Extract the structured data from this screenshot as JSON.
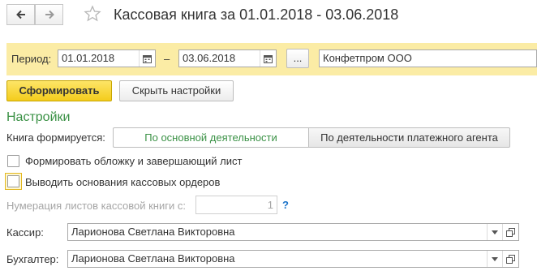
{
  "window": {
    "title": "Кассовая книга за 01.01.2018 - 03.06.2018",
    "nav_back_icon": "arrow-left-icon",
    "nav_forward_icon": "arrow-right-icon",
    "favorite_icon": "star-icon"
  },
  "period": {
    "label": "Период:",
    "date_from": "01.01.2018",
    "separator": "–",
    "date_to": "03.06.2018",
    "choose_button": "...",
    "organization": "Конфетпром ООО"
  },
  "toolbar": {
    "generate_label": "Сформировать",
    "hide_settings_label": "Скрыть настройки"
  },
  "settings": {
    "title": "Настройки",
    "book_mode_label": "Книга формируется:",
    "mode_main": "По основной деятельности",
    "mode_agent": "По деятельности платежного агента",
    "cover_label": "Формировать обложку и завершающий лист",
    "cover_checked": false,
    "reasons_label": "Выводить основания кассовых ордеров",
    "reasons_checked": false,
    "numbering_label": "Нумерация листов кассовой книги с:",
    "numbering_value": "1",
    "help": "?",
    "cashier_label": "Кассир:",
    "cashier_value": "Ларионова Светлана Викторовна",
    "accountant_label": "Бухгалтер:",
    "accountant_value": "Ларионова Светлана Викторовна"
  },
  "colors": {
    "accent_green": "#3a9145",
    "period_band": "#fbeca5",
    "primary_button": "#f4cc1c",
    "help_blue": "#1a73c9"
  }
}
